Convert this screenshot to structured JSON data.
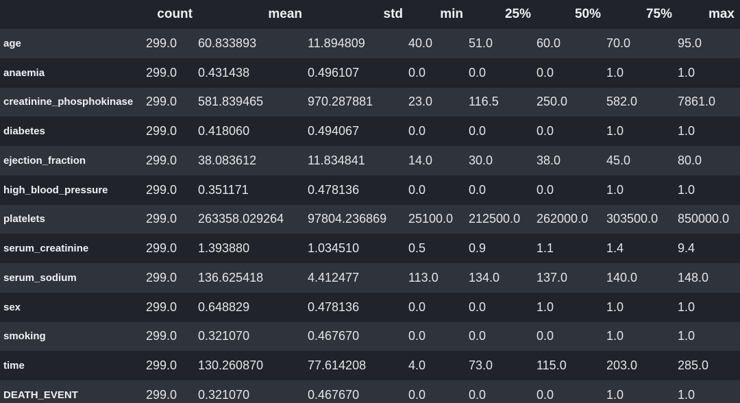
{
  "table": {
    "columns": [
      "count",
      "mean",
      "std",
      "min",
      "25%",
      "50%",
      "75%",
      "max"
    ],
    "rows": [
      {
        "label": "age",
        "cells": [
          "299.0",
          "60.833893",
          "11.894809",
          "40.0",
          "51.0",
          "60.0",
          "70.0",
          "95.0"
        ]
      },
      {
        "label": "anaemia",
        "cells": [
          "299.0",
          "0.431438",
          "0.496107",
          "0.0",
          "0.0",
          "0.0",
          "1.0",
          "1.0"
        ]
      },
      {
        "label": "creatinine_phosphokinase",
        "cells": [
          "299.0",
          "581.839465",
          "970.287881",
          "23.0",
          "116.5",
          "250.0",
          "582.0",
          "7861.0"
        ]
      },
      {
        "label": "diabetes",
        "cells": [
          "299.0",
          "0.418060",
          "0.494067",
          "0.0",
          "0.0",
          "0.0",
          "1.0",
          "1.0"
        ]
      },
      {
        "label": "ejection_fraction",
        "cells": [
          "299.0",
          "38.083612",
          "11.834841",
          "14.0",
          "30.0",
          "38.0",
          "45.0",
          "80.0"
        ]
      },
      {
        "label": "high_blood_pressure",
        "cells": [
          "299.0",
          "0.351171",
          "0.478136",
          "0.0",
          "0.0",
          "0.0",
          "1.0",
          "1.0"
        ]
      },
      {
        "label": "platelets",
        "cells": [
          "299.0",
          "263358.029264",
          "97804.236869",
          "25100.0",
          "212500.0",
          "262000.0",
          "303500.0",
          "850000.0"
        ]
      },
      {
        "label": "serum_creatinine",
        "cells": [
          "299.0",
          "1.393880",
          "1.034510",
          "0.5",
          "0.9",
          "1.1",
          "1.4",
          "9.4"
        ]
      },
      {
        "label": "serum_sodium",
        "cells": [
          "299.0",
          "136.625418",
          "4.412477",
          "113.0",
          "134.0",
          "137.0",
          "140.0",
          "148.0"
        ]
      },
      {
        "label": "sex",
        "cells": [
          "299.0",
          "0.648829",
          "0.478136",
          "0.0",
          "0.0",
          "1.0",
          "1.0",
          "1.0"
        ]
      },
      {
        "label": "smoking",
        "cells": [
          "299.0",
          "0.321070",
          "0.467670",
          "0.0",
          "0.0",
          "0.0",
          "1.0",
          "1.0"
        ]
      },
      {
        "label": "time",
        "cells": [
          "299.0",
          "130.260870",
          "77.614208",
          "4.0",
          "73.0",
          "115.0",
          "203.0",
          "285.0"
        ]
      },
      {
        "label": "DEATH_EVENT",
        "cells": [
          "299.0",
          "0.321070",
          "0.467670",
          "0.0",
          "0.0",
          "0.0",
          "1.0",
          "1.0"
        ]
      }
    ]
  },
  "colors": {
    "background": "#202329",
    "row_stripe": "#2f333b",
    "text": "#e6e7ea"
  }
}
